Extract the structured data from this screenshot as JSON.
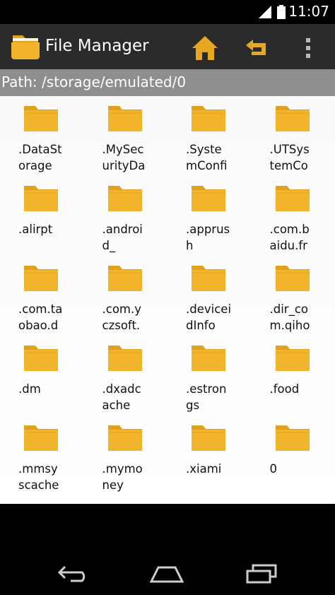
{
  "status_bar": {
    "time": "11:07"
  },
  "action_bar": {
    "title": "File Manager"
  },
  "path": {
    "label": "Path: /storage/emulated/0"
  },
  "folders": [
    {
      "label": ".DataSt\norage"
    },
    {
      "label": ".MySec\nurityDa"
    },
    {
      "label": ".Syste\nmConfi"
    },
    {
      "label": ".UTSys\ntemCo"
    },
    {
      "label": ".alirpt"
    },
    {
      "label": ".androi\nd_"
    },
    {
      "label": ".apprus\nh"
    },
    {
      "label": ".com.b\naidu.fr"
    },
    {
      "label": ".com.ta\nobao.d"
    },
    {
      "label": ".com.y\nczsoft."
    },
    {
      "label": ".devicei\ndInfo"
    },
    {
      "label": ".dir_co\nm.qiho"
    },
    {
      "label": ".dm"
    },
    {
      "label": ".dxadc\nache"
    },
    {
      "label": ".estron\ngs"
    },
    {
      "label": ".food"
    },
    {
      "label": ".mmsy\nscache"
    },
    {
      "label": ".mymo\nney"
    },
    {
      "label": ".xiami"
    },
    {
      "label": "0"
    }
  ],
  "colors": {
    "folder": "#f2b32d",
    "action_bar": "#2b2b2b",
    "path_bar": "#8e8e8e"
  },
  "icons": [
    "home-icon",
    "back-arrow-icon",
    "overflow-menu-icon",
    "folder-icon"
  ]
}
